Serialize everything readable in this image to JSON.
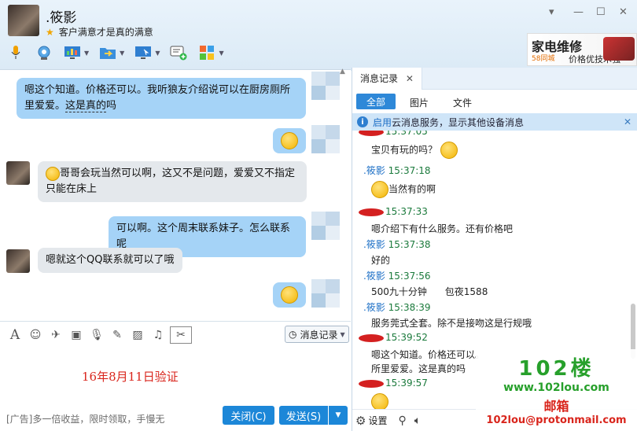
{
  "window": {
    "title": ".筱影",
    "status_text": "客户满意才是真的满意",
    "controls": [
      "▾",
      "—",
      "☐",
      "✕"
    ]
  },
  "toolbar": {
    "icons": [
      "microphone-icon",
      "camera-icon",
      "screen-share-icon",
      "file-transfer-icon",
      "remote-desktop-icon",
      "chat-add-icon",
      "apps-icon"
    ]
  },
  "top_ad": {
    "line1": "家电维修",
    "line2": "58同城",
    "line3": "价格优技术强"
  },
  "chat": {
    "messages": [
      {
        "side": "out",
        "text_a": "嗯这个知道。价格还可以。我听狼友介绍说可以在厨房厕所里爱爱。",
        "text_b": "这是真的",
        "text_c": "吗"
      },
      {
        "side": "out",
        "text": ""
      },
      {
        "side": "in",
        "text": "哥哥会玩当然可以啊，这又不是问题，爱爱又不指定只能在床上"
      },
      {
        "side": "out",
        "text": "可以啊。这个周末联系妹子。怎么联系呢"
      },
      {
        "side": "in",
        "text": "嗯就这个QQ联系就可以了哦"
      },
      {
        "side": "out",
        "text": ""
      }
    ]
  },
  "input_toolbar": {
    "history_button": "消息记录",
    "icons": [
      "font-icon",
      "emoji-icon",
      "nudge-icon",
      "screenshot-icon",
      "voice-icon",
      "edit-icon",
      "image-icon",
      "music-icon",
      "scissors-icon"
    ]
  },
  "watermark_left": "16年8月11日验证",
  "footer": {
    "ad_text": "[广告]多一倍收益，限时领取，手慢无",
    "close_label": "关闭(C)",
    "send_label": "发送(S)"
  },
  "history": {
    "tab_label": "消息记录",
    "filters": {
      "all": "全部",
      "images": "图片",
      "files": "文件"
    },
    "notice": {
      "link": "启用",
      "text": "云消息服务，显示其他设备消息"
    },
    "entries": [
      {
        "type": "time",
        "name": "",
        "time": "15:37:05",
        "redacted": true
      },
      {
        "type": "text",
        "text": "宝贝有玩的吗？"
      },
      {
        "type": "time",
        "name": ".筱影",
        "time": "15:37:18",
        "redacted": false
      },
      {
        "type": "text",
        "text": "当然有的啊"
      },
      {
        "type": "time",
        "name": "",
        "time": "15:37:33",
        "redacted": true
      },
      {
        "type": "text",
        "text": "嗯介绍下有什么服务。还有价格吧"
      },
      {
        "type": "time",
        "name": ".筱影",
        "time": "15:37:38",
        "redacted": false
      },
      {
        "type": "text",
        "text": "好的"
      },
      {
        "type": "time",
        "name": ".筱影",
        "time": "15:37:56",
        "redacted": false
      },
      {
        "type": "text",
        "text": "500九十分钟      包夜1588"
      },
      {
        "type": "time",
        "name": ".筱影",
        "time": "15:38:39",
        "redacted": false
      },
      {
        "type": "text",
        "text": "服务莞式全套。除不是接吻这是行规哦"
      },
      {
        "type": "time",
        "name": "",
        "time": "15:39:52",
        "redacted": true
      },
      {
        "type": "text",
        "text": "嗯这个知道。价格还可以。"
      },
      {
        "type": "text",
        "text": "所里爱爱。这是真的吗"
      },
      {
        "type": "time",
        "name": "",
        "time": "15:39:57",
        "redacted": true
      }
    ],
    "settings_label": "设置"
  },
  "watermark_right": {
    "line1": "102楼",
    "line2": "www.102lou.com",
    "line3": "邮箱",
    "line4": "102lou@protonmail.com"
  }
}
